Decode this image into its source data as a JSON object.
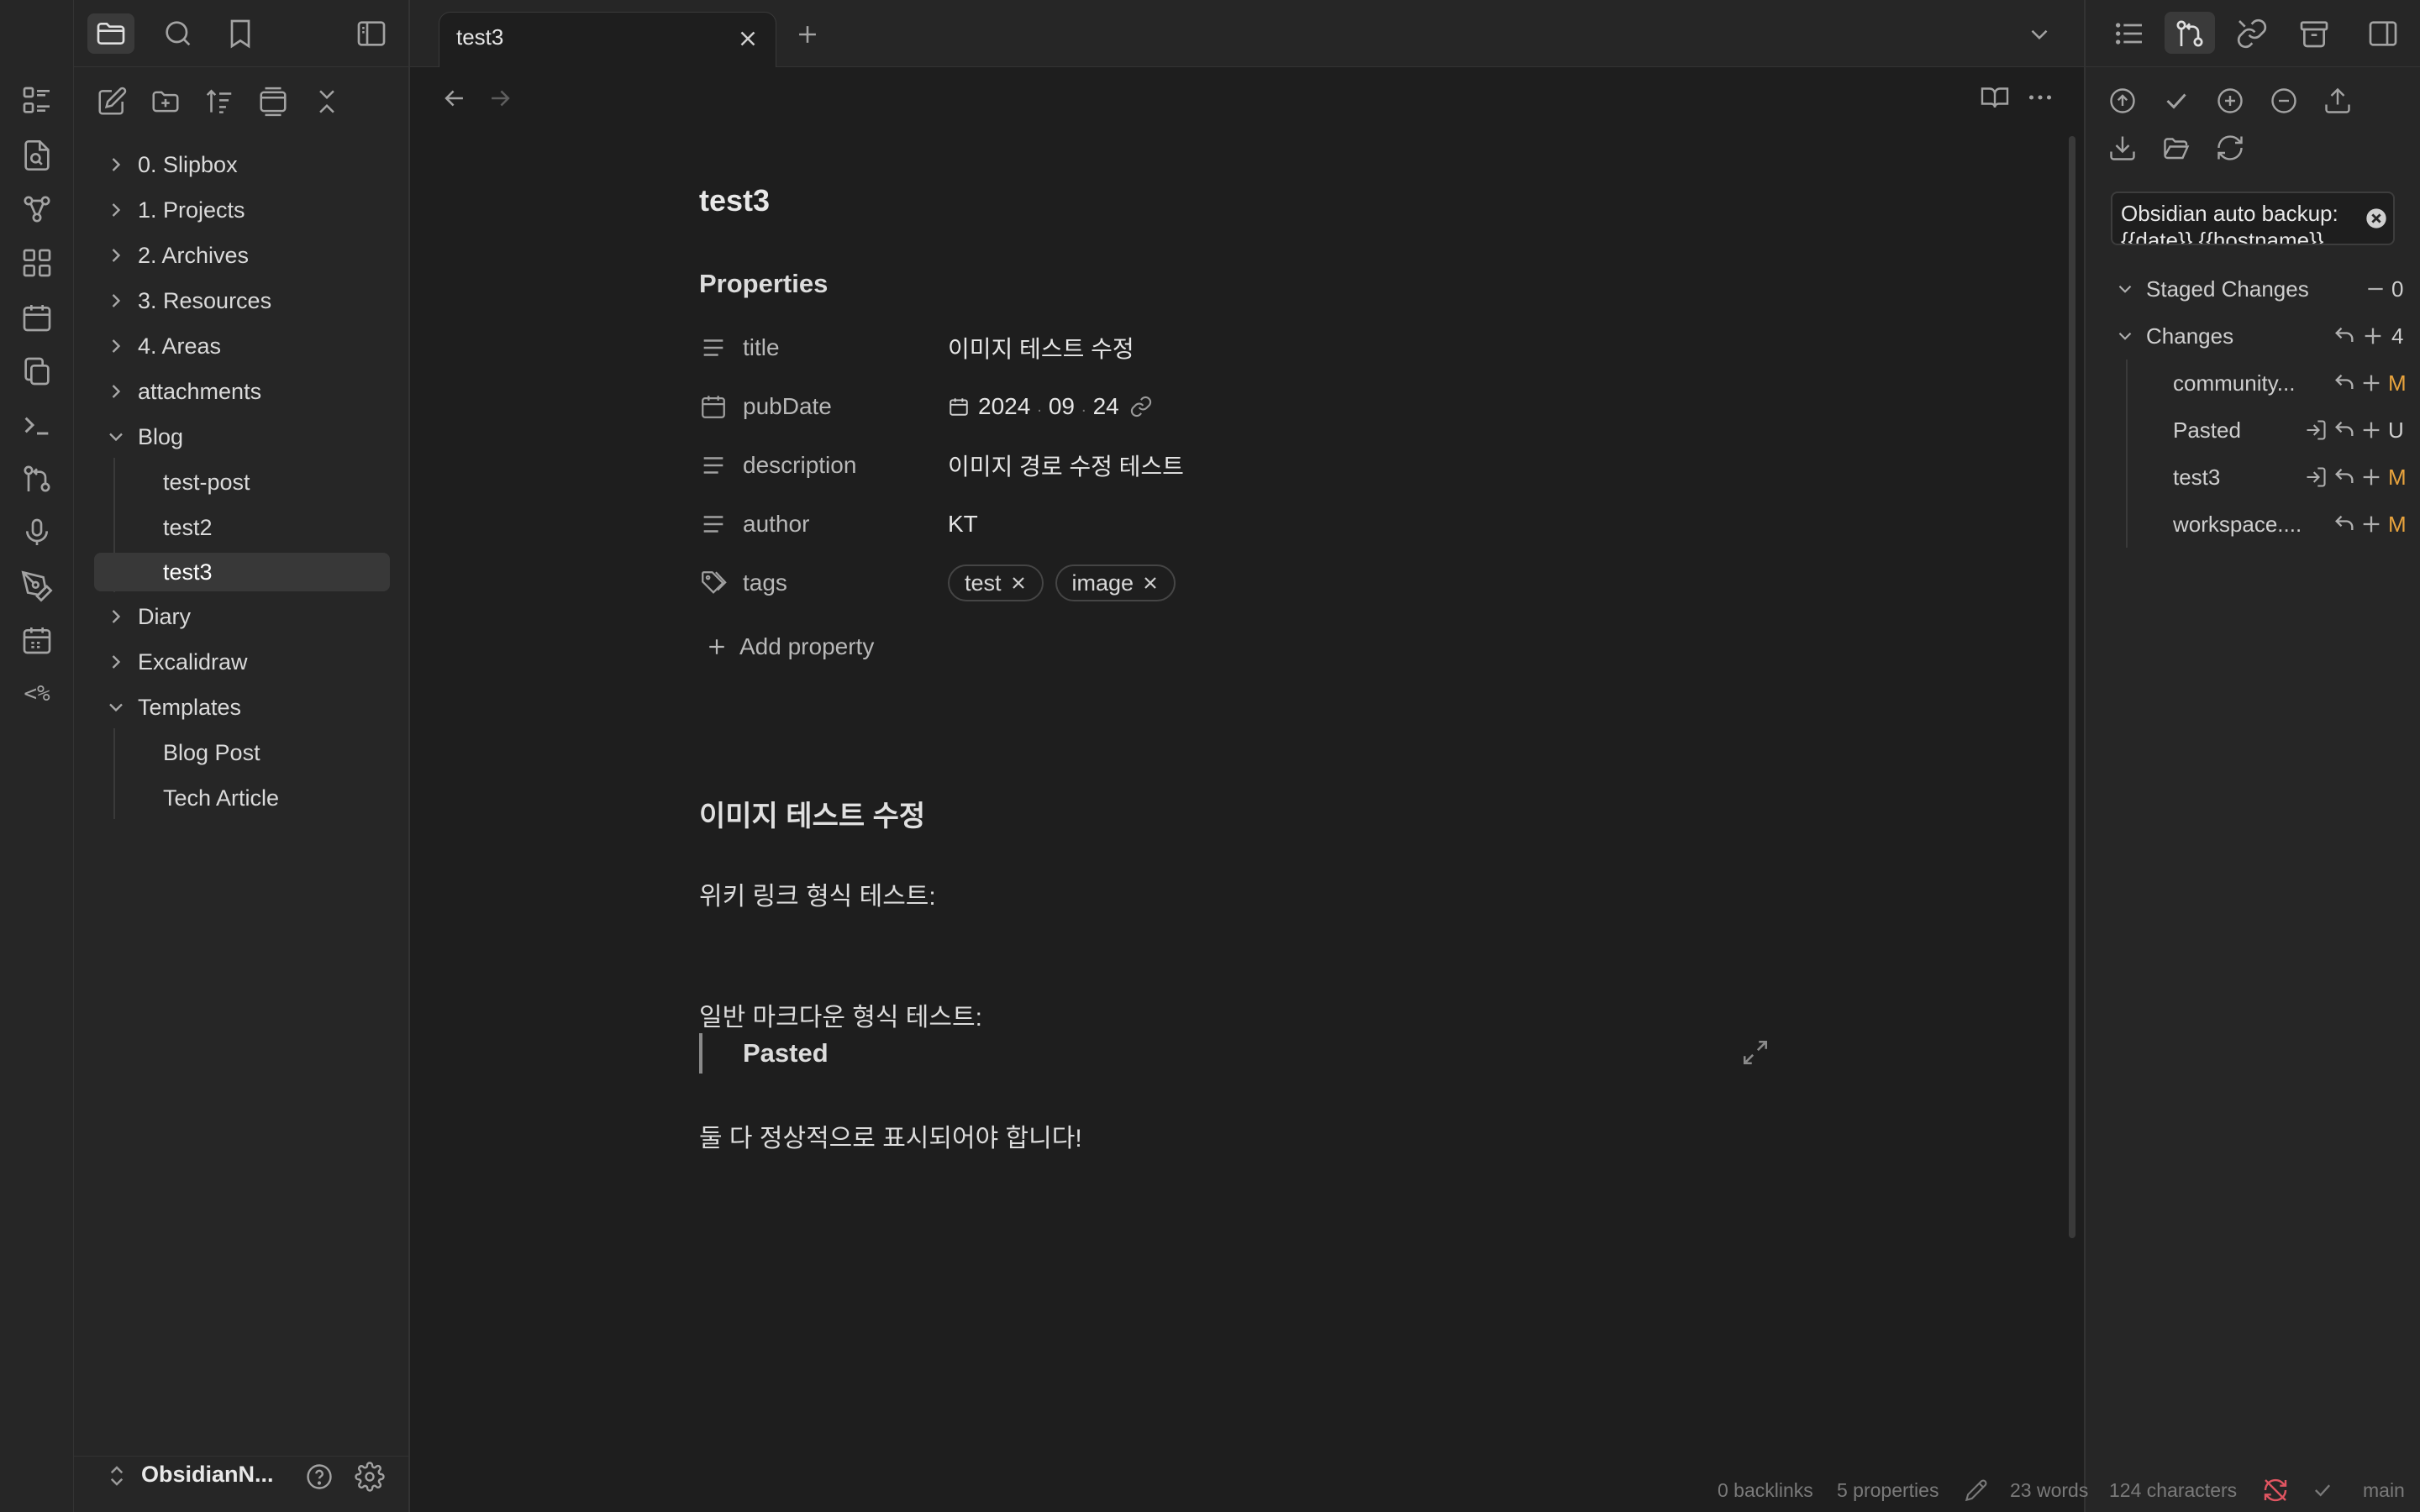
{
  "colors": {
    "accent": "#e8a33d",
    "warning_red": "#e05561",
    "modified": "#e8a33d",
    "background": "#1e1e1e",
    "sidebar": "#262626"
  },
  "ribbon": {
    "icons": [
      "dashboard-icon",
      "file-search-icon",
      "graph-icon",
      "blocks-icon",
      "calendar-icon",
      "copy-files-icon",
      "terminal-icon",
      "git-icon",
      "microphone-icon",
      "pen-icon",
      "daily-calendar-icon",
      "templater-icon"
    ],
    "templater_label": "<%"
  },
  "left_sidebar": {
    "tree": [
      {
        "label": "0. Slipbox",
        "expanded": false
      },
      {
        "label": "1. Projects",
        "expanded": false
      },
      {
        "label": "2. Archives",
        "expanded": false
      },
      {
        "label": "3. Resources",
        "expanded": false
      },
      {
        "label": "4. Areas",
        "expanded": false
      },
      {
        "label": "attachments",
        "expanded": false
      },
      {
        "label": "Blog",
        "expanded": true
      },
      {
        "label": "Diary",
        "expanded": false
      },
      {
        "label": "Excalidraw",
        "expanded": false
      },
      {
        "label": "Templates",
        "expanded": true
      }
    ],
    "blog_children": [
      "test-post",
      "test2",
      "test3"
    ],
    "templates_children": [
      "Blog Post",
      "Tech Article"
    ],
    "active_file": "test3",
    "vault_name": "ObsidianN..."
  },
  "tabs": [
    {
      "title": "test3",
      "active": true
    }
  ],
  "note": {
    "title": "test3",
    "properties_heading": "Properties",
    "properties": [
      {
        "key": "title",
        "icon": "text-lines-icon",
        "value": "이미지 테스트 수정"
      },
      {
        "key": "pubDate",
        "icon": "calendar-icon",
        "value_year": "2024",
        "value_month": "09",
        "value_day": "24"
      },
      {
        "key": "description",
        "icon": "text-lines-icon",
        "value": "이미지 경로 수정 테스트"
      },
      {
        "key": "author",
        "icon": "text-lines-icon",
        "value": "KT"
      },
      {
        "key": "tags",
        "icon": "tags-icon",
        "tags": [
          "test",
          "image"
        ]
      }
    ],
    "add_property": "Add property",
    "heading": "이미지 테스트 수정",
    "para1": "위키 링크 형식 테스트:",
    "para2": "일반 마크다운 형식 테스트:",
    "blockquote": "Pasted",
    "para3": "둘 다 정상적으로 표시되어야 합니다!"
  },
  "git_panel": {
    "commit_message": "Obsidian auto backup: {{date}} {{hostname}}",
    "staged": {
      "label": "Staged Changes",
      "count": "0"
    },
    "changes": {
      "label": "Changes",
      "count": "4"
    },
    "files": [
      {
        "name": "community...",
        "status": "M",
        "has_open": false
      },
      {
        "name": "Pasted",
        "status": "U",
        "has_open": true
      },
      {
        "name": "test3",
        "status": "M",
        "has_open": true
      },
      {
        "name": "workspace....",
        "status": "M",
        "has_open": false
      }
    ]
  },
  "status_bar": {
    "backlinks": "0 backlinks",
    "properties": "5 properties",
    "words": "23 words",
    "characters": "124 characters",
    "branch": "main"
  }
}
